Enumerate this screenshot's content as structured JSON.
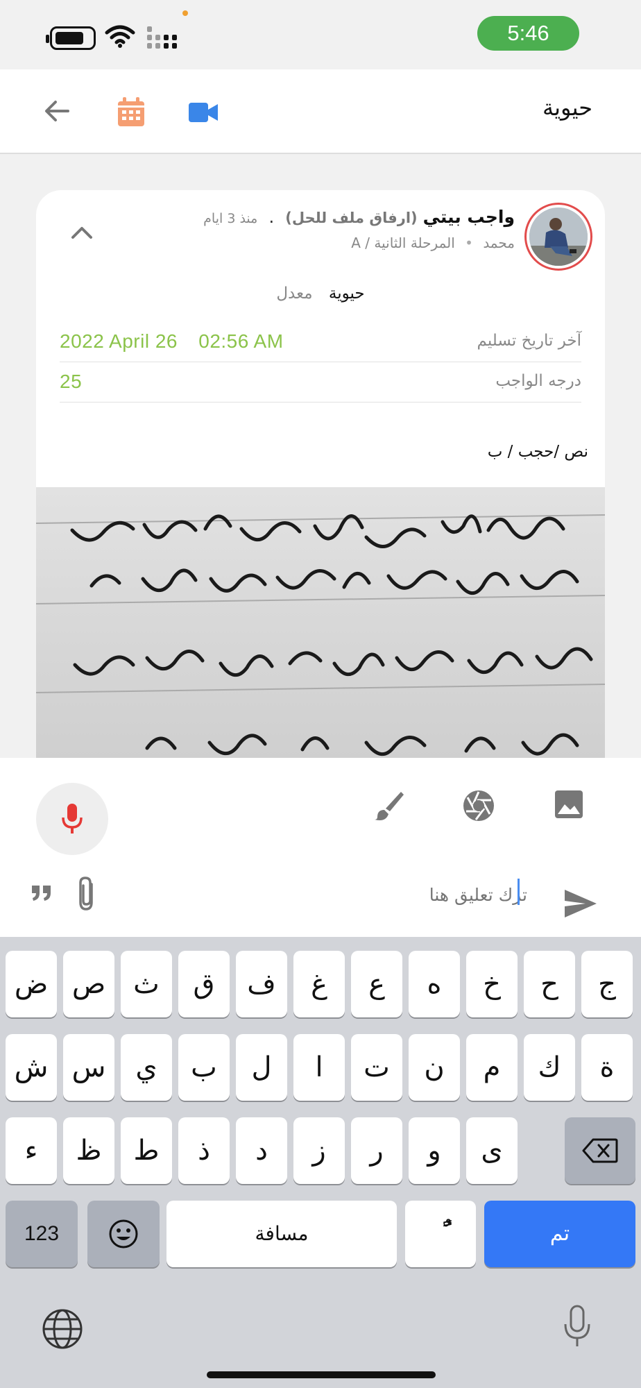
{
  "status_bar": {
    "time": "5:46",
    "time_pill_color": "#4caf50"
  },
  "header": {
    "title": "حيوية",
    "icons": [
      "back-arrow-icon",
      "calendar-icon",
      "video-call-icon"
    ]
  },
  "post": {
    "title": "واجب بيتي",
    "subtitle": "(ارفاق ملف للحل)",
    "dot": ".",
    "since": "منذ 3 ايام",
    "author": "محمد",
    "stage": "المرحلة الثانية / A",
    "subject": "حيوية",
    "edited": "معدل",
    "deadline_label": "آخر تاريخ تسليم",
    "deadline_date": "2022 April 26",
    "deadline_time": "02:56 AM",
    "grade_label": "درجه الواجب",
    "grade_value": "25",
    "description": "نص /حجب / ب",
    "accent_green": "#8bc34a"
  },
  "comment": {
    "placeholder": "ترك تعليق هنا"
  },
  "keyboard": {
    "row1": [
      "ض",
      "ص",
      "ث",
      "ق",
      "ف",
      "غ",
      "ع",
      "ه",
      "خ",
      "ح",
      "ج"
    ],
    "row2": [
      "ش",
      "س",
      "ي",
      "ب",
      "ل",
      "ا",
      "ت",
      "ن",
      "م",
      "ك",
      "ة"
    ],
    "row3": [
      "ء",
      "ظ",
      "ط",
      "ذ",
      "د",
      "ز",
      "ر",
      "و",
      "ى"
    ],
    "numbers_key": "123",
    "space_key": "مسافة",
    "diacritic_key": "ًٌ",
    "done_key": "تم",
    "done_color": "#3478f6"
  }
}
